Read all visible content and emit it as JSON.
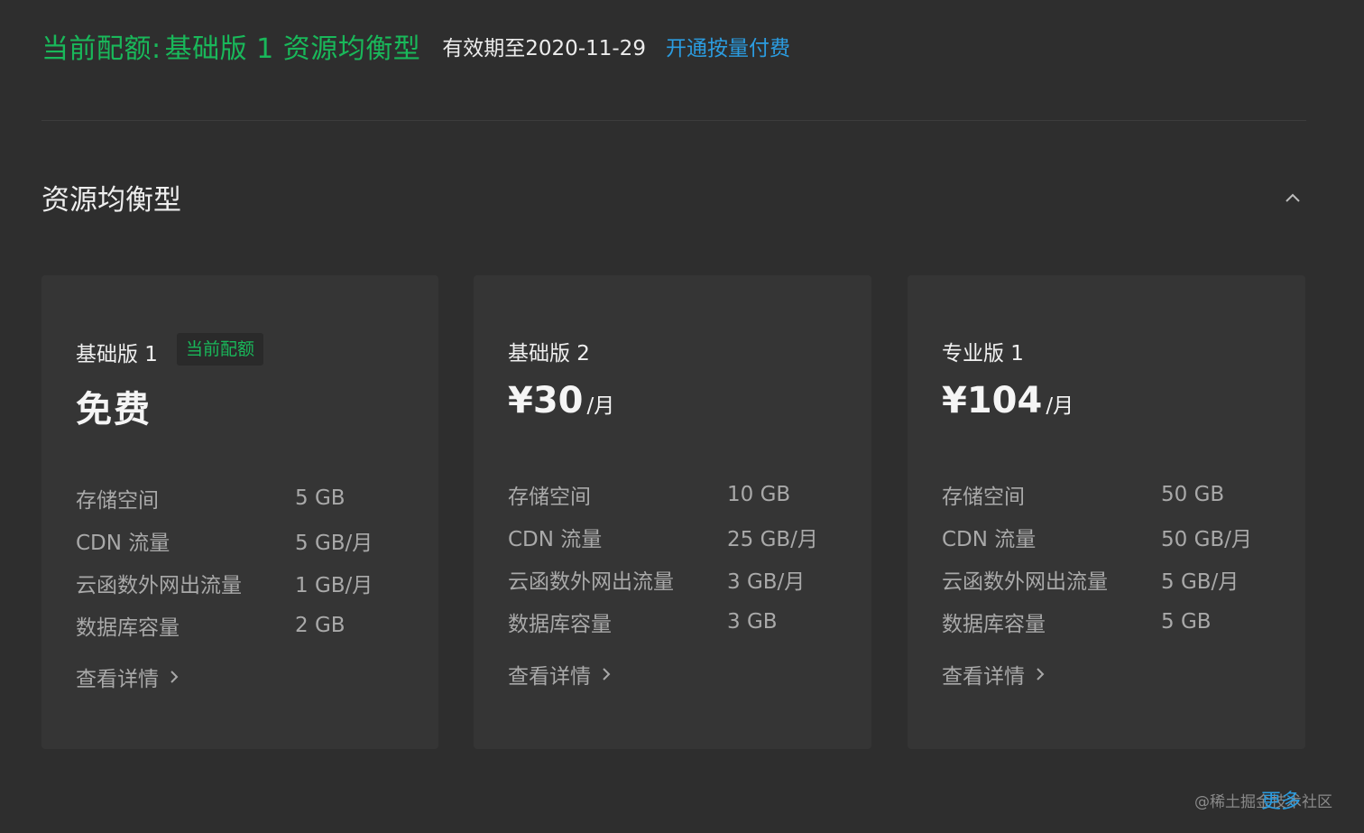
{
  "header": {
    "quota_label": "当前配额:",
    "quota_value": "基础版 1 资源均衡型",
    "valid_until": "有效期至2020-11-29",
    "open_link": "开通按量付费"
  },
  "section": {
    "title": "资源均衡型",
    "toggle_icon": "chevron-up-icon"
  },
  "plans": [
    {
      "name": "基础版 1",
      "badge": "当前配额",
      "price_text": "免费",
      "specs": [
        {
          "label": "存储空间",
          "value": "5 GB"
        },
        {
          "label": "CDN 流量",
          "value": "5 GB/月"
        },
        {
          "label": "云函数外网出流量",
          "value": "1 GB/月"
        },
        {
          "label": "数据库容量",
          "value": "2 GB"
        }
      ],
      "details_link": "查看详情"
    },
    {
      "name": "基础版 2",
      "price": "¥30",
      "price_unit": "/月",
      "specs": [
        {
          "label": "存储空间",
          "value": "10 GB"
        },
        {
          "label": "CDN 流量",
          "value": "25 GB/月"
        },
        {
          "label": "云函数外网出流量",
          "value": "3 GB/月"
        },
        {
          "label": "数据库容量",
          "value": "3 GB"
        }
      ],
      "details_link": "查看详情"
    },
    {
      "name": "专业版 1",
      "price": "¥104",
      "price_unit": "/月",
      "specs": [
        {
          "label": "存储空间",
          "value": "50 GB"
        },
        {
          "label": "CDN 流量",
          "value": "50 GB/月"
        },
        {
          "label": "云函数外网出流量",
          "value": "5 GB/月"
        },
        {
          "label": "数据库容量",
          "value": "5 GB"
        }
      ],
      "details_link": "查看详情"
    }
  ],
  "footer": {
    "watermark": "@稀土掘金技术社区",
    "more_link": "更多"
  },
  "colors": {
    "background": "#2e2e2e",
    "card": "#353535",
    "accent_green": "#19b85a",
    "link_blue": "#2b9ce0"
  }
}
